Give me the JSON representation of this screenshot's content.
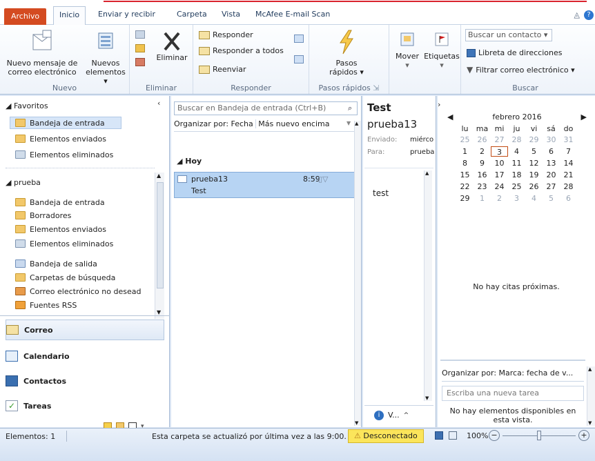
{
  "tabs": [
    "Archivo",
    "Inicio",
    "Enviar y recibir",
    "Carpeta",
    "Vista",
    "McAfee E-mail Scan"
  ],
  "ribbon": {
    "nuevo": {
      "new_message": [
        "Nuevo mensaje de",
        "correo electrónico"
      ],
      "new_items": [
        "Nuevos",
        "elementos ▾"
      ],
      "label": "Nuevo"
    },
    "eliminar": {
      "delete": "Eliminar",
      "label": "Eliminar"
    },
    "responder": {
      "reply": "Responder",
      "reply_all": "Responder a todos",
      "forward": "Reenviar",
      "label": "Responder"
    },
    "pasos": {
      "quick_steps": [
        "Pasos",
        "rápidos ▾"
      ],
      "label": "Pasos rápidos"
    },
    "mover": {
      "move": "Mover",
      "tags": "Etiquetas"
    },
    "buscar": {
      "find_contact": "Buscar un contacto ▾",
      "address_book": "Libreta de direcciones",
      "filter_email": "Filtrar correo electrónico ▾",
      "label": "Buscar"
    }
  },
  "nav": {
    "favorites_header": "◢ Favoritos",
    "favorites": [
      "Bandeja de entrada",
      "Elementos enviados",
      "Elementos eliminados"
    ],
    "account_header": "◢ prueba",
    "folders": [
      "Bandeja de entrada",
      "Borradores",
      "Elementos enviados",
      "Elementos eliminados",
      "Bandeja de salida",
      "Carpetas de búsqueda",
      "Correo electrónico no desead",
      "Fuentes RSS"
    ],
    "modules": [
      "Correo",
      "Calendario",
      "Contactos",
      "Tareas"
    ]
  },
  "list": {
    "search_placeholder": "Buscar en Bandeja de entrada (Ctrl+B)",
    "sort_by": "Organizar por: Fecha",
    "sort_order": "Más nuevo encima",
    "group": "◢ Hoy",
    "message": {
      "from": "prueba13",
      "subject": "Test",
      "time": "8:59"
    }
  },
  "reading": {
    "subject": "Test",
    "from": "prueba13",
    "sent_label": "Enviado:",
    "sent_value": "miérco",
    "to_label": "Para:",
    "to_value": "prueba",
    "body": "test",
    "footer_text": "V..."
  },
  "todo": {
    "month": "febrero 2016",
    "weekdays": [
      "lu",
      "ma",
      "mi",
      "ju",
      "vi",
      "sá",
      "do"
    ],
    "weeks": [
      [
        "25",
        "26",
        "27",
        "28",
        "29",
        "30",
        "31"
      ],
      [
        "1",
        "2",
        "3",
        "4",
        "5",
        "6",
        "7"
      ],
      [
        "8",
        "9",
        "10",
        "11",
        "12",
        "13",
        "14"
      ],
      [
        "15",
        "16",
        "17",
        "18",
        "19",
        "20",
        "21"
      ],
      [
        "22",
        "23",
        "24",
        "25",
        "26",
        "27",
        "28"
      ],
      [
        "29",
        "1",
        "2",
        "3",
        "4",
        "5",
        "6"
      ]
    ],
    "today": "3",
    "no_appointments": "No hay citas próximas.",
    "task_sort": "Organizar por: Marca: fecha de v...",
    "task_placeholder": "Escriba una nueva tarea",
    "no_items": "No hay elementos disponibles en esta vista."
  },
  "status": {
    "items": "Elementos: 1",
    "updated": "Esta carpeta se actualizó por última vez a las 9:00.",
    "connection": "Desconectado",
    "zoom": "100%"
  }
}
